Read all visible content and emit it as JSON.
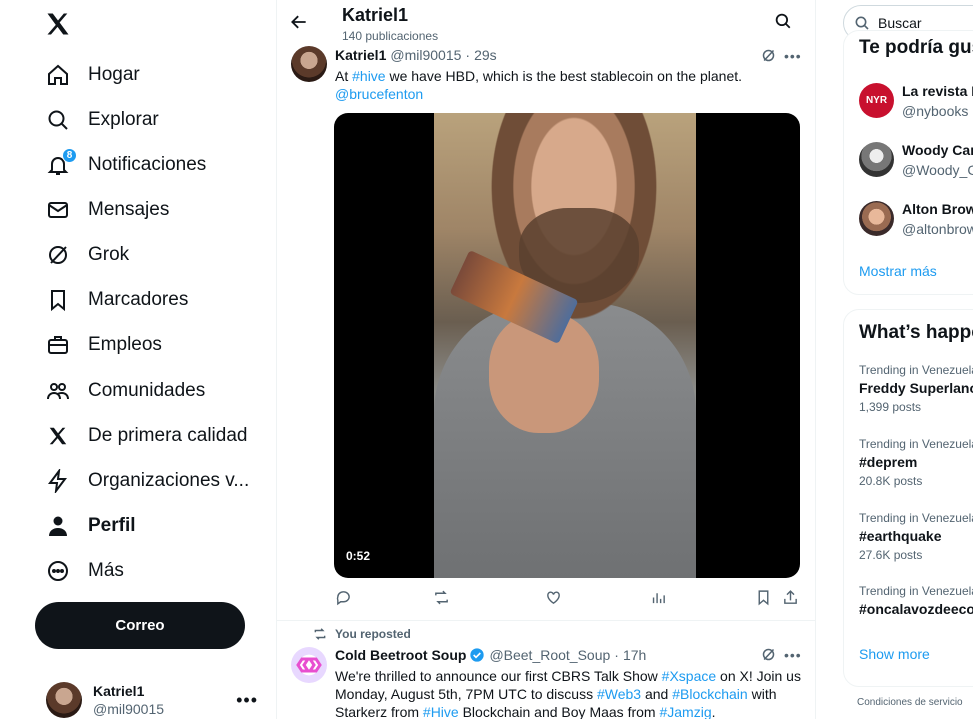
{
  "nav": {
    "items": [
      {
        "label": "Hogar",
        "icon": "home-icon"
      },
      {
        "label": "Explorar",
        "icon": "search-icon"
      },
      {
        "label": "Notificaciones",
        "icon": "bell-icon",
        "badge": "8"
      },
      {
        "label": "Mensajes",
        "icon": "mail-icon"
      },
      {
        "label": "Grok",
        "icon": "grok-icon"
      },
      {
        "label": "Marcadores",
        "icon": "bookmark-icon"
      },
      {
        "label": "Empleos",
        "icon": "briefcase-icon"
      },
      {
        "label": "Comunidades",
        "icon": "communities-icon"
      },
      {
        "label": "De primera calidad",
        "icon": "x-logo-icon"
      },
      {
        "label": "Organizaciones v...",
        "icon": "lightning-icon"
      },
      {
        "label": "Perfil",
        "icon": "person-icon"
      },
      {
        "label": "Más",
        "icon": "more-circle-icon"
      }
    ],
    "post_button": "Correo",
    "account": {
      "name": "Katriel1",
      "handle": "@mil90015"
    }
  },
  "header": {
    "title": "Katriel1",
    "subtitle": "140 publicaciones"
  },
  "tweets": [
    {
      "name": "Katriel1",
      "handle": "@mil90015",
      "time": "29s",
      "text_parts": [
        "At ",
        "#hive",
        " we have HBD, which is the best stablecoin on the planet."
      ],
      "mention": "@brucefenton",
      "video_duration": "0:52"
    },
    {
      "repost_label": "You reposted",
      "name": "Cold Beetroot Soup",
      "handle": "@Beet_Root_Soup",
      "time": "17h",
      "line1": [
        "We're thrilled to announce our first CBRS Talk Show ",
        "#Xspace",
        " on X! Join us"
      ],
      "line2": [
        "Monday, August 5th, 7PM UTC to discuss ",
        "#Web3",
        " and ",
        "#Blockchain",
        " with"
      ],
      "line3": [
        "Starkerz from ",
        "#Hive",
        " Blockchain and Boy Maas from ",
        "#Jamzig",
        "."
      ]
    }
  ],
  "right": {
    "search_placeholder": "Buscar",
    "who_to_follow": {
      "title": "Te podría gus",
      "accounts": [
        {
          "name": "La revista N",
          "handle": "@nybooks",
          "avatar_text": "NYR"
        },
        {
          "name": "Woody Cam",
          "handle": "@Woody_Ca"
        },
        {
          "name": "Alton Brow",
          "handle": "@altonbrow"
        }
      ],
      "more": "Mostrar más"
    },
    "trends": {
      "title": "What’s happe",
      "items": [
        {
          "context": "Trending in Venezuela",
          "name": "Freddy Superlano",
          "posts": "1,399 posts"
        },
        {
          "context": "Trending in Venezuela",
          "name": "#deprem",
          "posts": "20.8K posts"
        },
        {
          "context": "Trending in Venezuela",
          "name": "#earthquake",
          "posts": "27.6K posts"
        },
        {
          "context": "Trending in Venezuela",
          "name": "#oncalavozdeeco",
          "posts": ""
        }
      ],
      "more": "Show more"
    },
    "footer": "Condiciones de servicio"
  },
  "colors": {
    "accent": "#1d9bf0",
    "text": "#0f1419",
    "muted": "#536471"
  }
}
